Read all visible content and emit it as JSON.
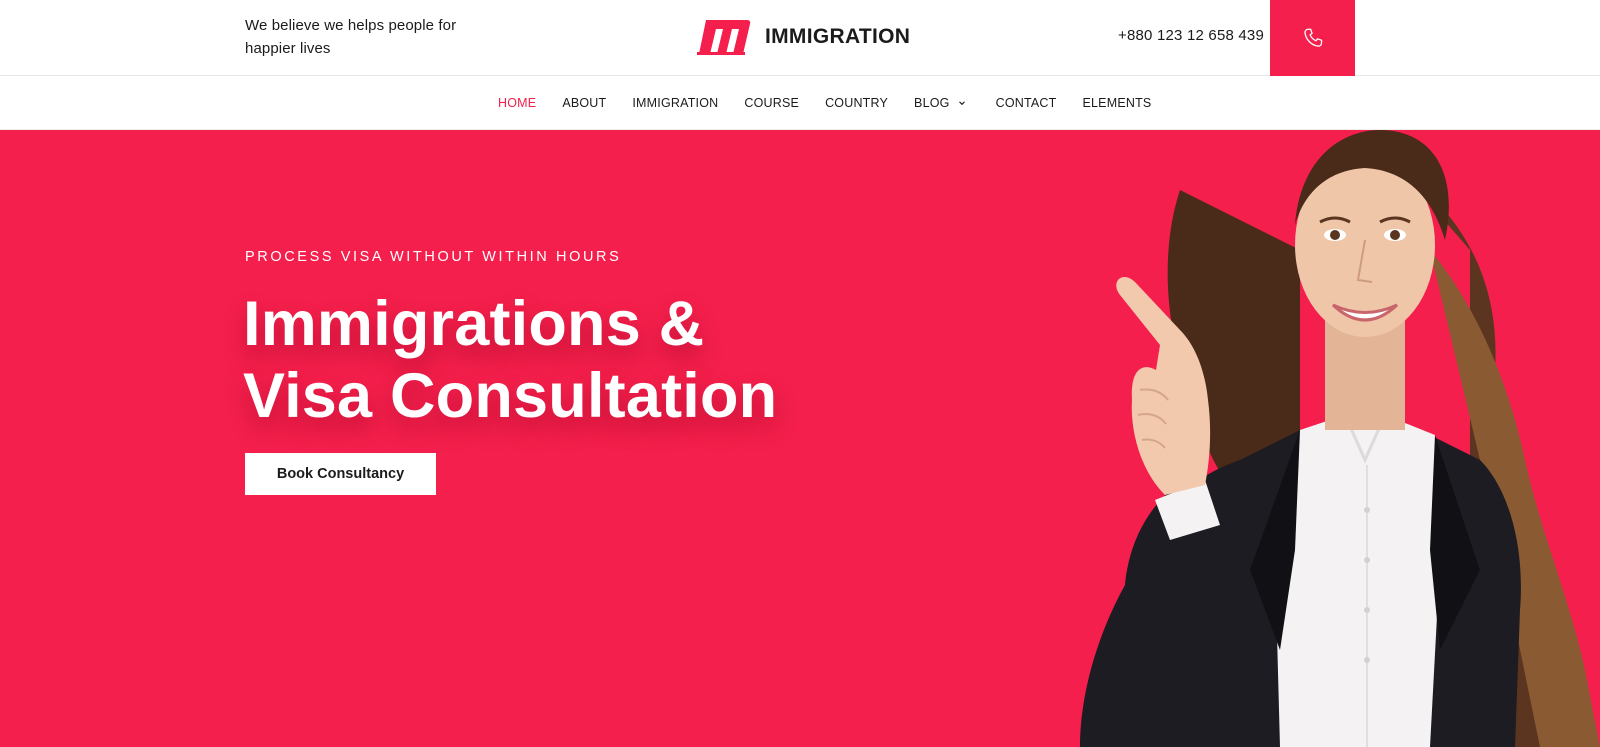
{
  "header": {
    "tagline": "We believe we helps people for happier lives",
    "brand_name": "IMMIGRATION",
    "phone": "+880 123 12 658 439"
  },
  "nav": {
    "items": [
      {
        "label": "HOME",
        "active": true
      },
      {
        "label": "ABOUT"
      },
      {
        "label": "IMMIGRATION"
      },
      {
        "label": "COURSE"
      },
      {
        "label": "COUNTRY"
      },
      {
        "label": "BLOG",
        "has_dropdown": true
      },
      {
        "label": "CONTACT"
      },
      {
        "label": "ELEMENTS"
      }
    ]
  },
  "hero": {
    "kicker": "PROCESS VISA WITHOUT WITHIN HOURS",
    "title_line1": "Immigrations &",
    "title_line2": "Visa Consultation",
    "cta_label": "Book Consultancy"
  },
  "colors": {
    "accent": "#f41f4c",
    "text": "#1b1b1b",
    "background": "#ffffff"
  },
  "icons": {
    "brand": "brand-logo-m-icon",
    "phone": "phone-icon",
    "dropdown": "chevron-down-icon"
  }
}
